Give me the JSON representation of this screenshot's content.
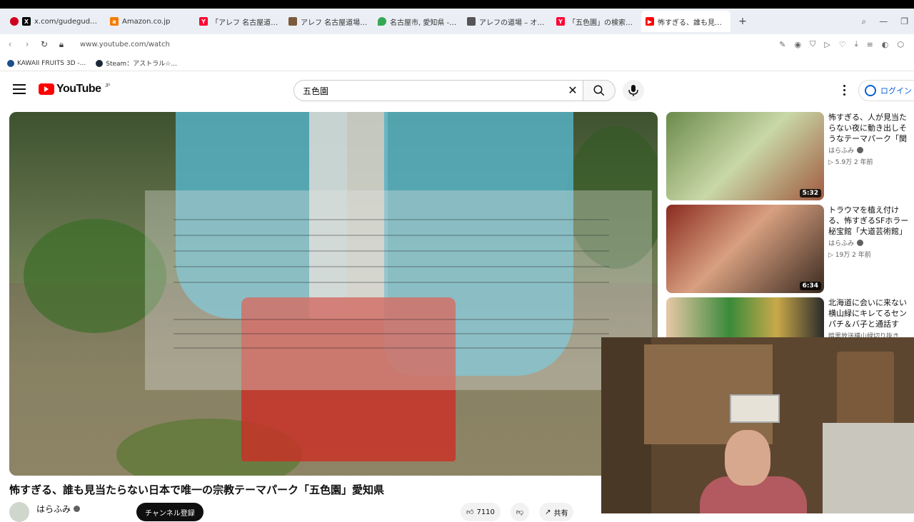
{
  "browser": {
    "tabs": [
      {
        "label": "x.com/gudegude147/statu",
        "favicon": "x-icon",
        "color": "#000000"
      },
      {
        "label": "Amazon.co.jp",
        "favicon": "amazon-icon",
        "color": "#f57c00"
      },
      {
        "label": "「アレフ 名古屋道場」の検索",
        "favicon": "yahoo-icon",
        "color": "#ff0033"
      },
      {
        "label": "アレフ 名古屋道場 - 雪だるま",
        "favicon": "web-icon",
        "color": "#7a5a3a"
      },
      {
        "label": "名古屋市, 愛知県 - Google",
        "favicon": "maps-icon",
        "color": "#34a853"
      },
      {
        "label": "アレフの道場 – オウム真理教",
        "favicon": "doc-icon",
        "color": "#555555"
      },
      {
        "label": "「五色園」の検索結果 - Yah",
        "favicon": "yahoo-icon",
        "color": "#ff0033"
      },
      {
        "label": "怖すぎる、誰も見当たら",
        "favicon": "youtube-icon",
        "color": "#ff0000",
        "active": true
      }
    ],
    "url": "www.youtube.com/watch",
    "bookmarks": [
      "KAWAII FRUITS 3D -...",
      "Steam：アストラル☆..."
    ]
  },
  "header": {
    "logo_text": "YouTube",
    "region": "JP",
    "search_value": "五色園",
    "login_label": "ログイン"
  },
  "video": {
    "title": "怖すぎる、誰も見当たらない日本で唯一の宗教テーマパーク「五色園」愛知県",
    "channel": "はらふみ",
    "subscribe_label": "チャンネル登録",
    "likes": "7110",
    "share_label": "共有"
  },
  "sidebar": {
    "items": [
      {
        "title": "怖すぎる、人が見当たらない夜に動き出しそうなテーマパーク「関ヶ原ウォー...",
        "channel": "はらふみ",
        "meta": "5.9万  2 年前",
        "duration": "5:32",
        "thumb_color": "#6b8a4a"
      },
      {
        "title": "トラウマを植え付ける、怖すぎるSFホラー秘宝館「大道芸術館」東京都墨...",
        "channel": "はらふみ",
        "meta": "19万  2 年前",
        "duration": "6:34",
        "thumb_color": "#8a2a20"
      },
      {
        "title": "北海道に会いに来ない横山緑にキレてるセンパチ＆バ子と通話する...",
        "channel": "暗黒放送横山緑切り抜き",
        "meta": "",
        "duration": "",
        "thumb_color": "#c9a94a"
      }
    ]
  }
}
